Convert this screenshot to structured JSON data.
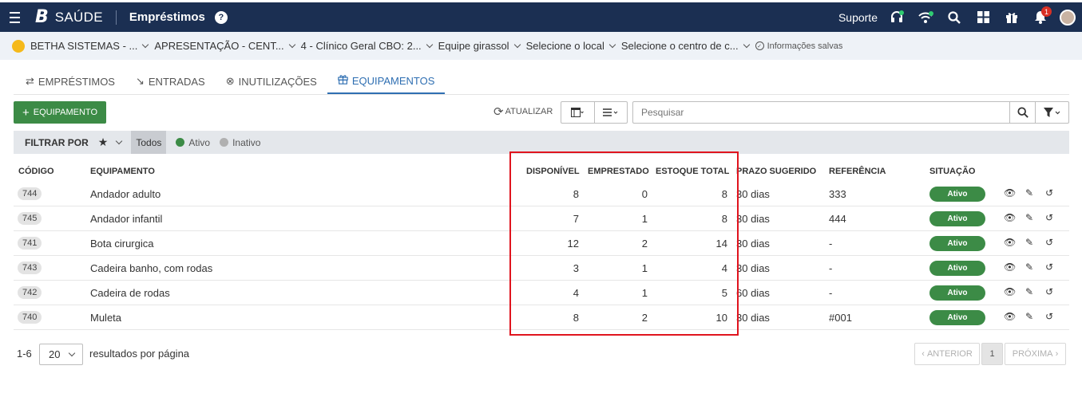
{
  "topbar": {
    "logo": "B",
    "brand": "SAÚDE",
    "module": "Empréstimos",
    "help": "?",
    "support_label": "Suporte",
    "notification_count": "1"
  },
  "context": {
    "items": [
      "BETHA SISTEMAS - ...",
      "APRESENTAÇÃO - CENT...",
      "4 - Clínico Geral CBO: 2...",
      "Equipe girassol",
      "Selecione o local",
      "Selecione o centro de c..."
    ],
    "saved_label": "Informações salvas"
  },
  "tabs": [
    {
      "label": "Empréstimos",
      "icon": "⇄"
    },
    {
      "label": "Entradas",
      "icon": "↘"
    },
    {
      "label": "Inutilizações",
      "icon": "⊗"
    },
    {
      "label": "Equipamentos",
      "icon": "🎁"
    }
  ],
  "toolbar": {
    "add_label": "Equipamento",
    "refresh_label": "Atualizar",
    "search_placeholder": "Pesquisar"
  },
  "filter": {
    "label": "Filtrar por",
    "todos": "Todos",
    "ativo": "Ativo",
    "inativo": "Inativo",
    "ativo_color": "#3c8b46",
    "inativo_color": "#b0b0b0"
  },
  "table": {
    "headers": {
      "codigo": "Código",
      "equipamento": "Equipamento",
      "disponivel": "Disponível",
      "emprestado": "Emprestado",
      "estoque": "Estoque total",
      "prazo": "Prazo sugerido",
      "referencia": "Referência",
      "situacao": "Situação"
    },
    "rows": [
      {
        "code": "744",
        "name": "Andador adulto",
        "disponivel": "8",
        "emprestado": "0",
        "estoque": "8",
        "prazo": "30 dias",
        "ref": "333",
        "status": "Ativo"
      },
      {
        "code": "745",
        "name": "Andador infantil",
        "disponivel": "7",
        "emprestado": "1",
        "estoque": "8",
        "prazo": "30 dias",
        "ref": "444",
        "status": "Ativo"
      },
      {
        "code": "741",
        "name": "Bota cirurgica",
        "disponivel": "12",
        "emprestado": "2",
        "estoque": "14",
        "prazo": "30 dias",
        "ref": "-",
        "status": "Ativo"
      },
      {
        "code": "743",
        "name": "Cadeira banho, com rodas",
        "disponivel": "3",
        "emprestado": "1",
        "estoque": "4",
        "prazo": "30 dias",
        "ref": "-",
        "status": "Ativo"
      },
      {
        "code": "742",
        "name": "Cadeira de rodas",
        "disponivel": "4",
        "emprestado": "1",
        "estoque": "5",
        "prazo": "60 dias",
        "ref": "-",
        "status": "Ativo"
      },
      {
        "code": "740",
        "name": "Muleta",
        "disponivel": "8",
        "emprestado": "2",
        "estoque": "10",
        "prazo": "30 dias",
        "ref": "#001",
        "status": "Ativo"
      }
    ]
  },
  "footer": {
    "range": "1-6",
    "per_page": "20",
    "per_page_label": "resultados por página",
    "prev": "Anterior",
    "current_page": "1",
    "next": "Próxima"
  },
  "colors": {
    "topbar": "#1b2f52",
    "accent": "#2f6fb2",
    "success": "#3c8b46",
    "highlight": "#e0141e"
  }
}
